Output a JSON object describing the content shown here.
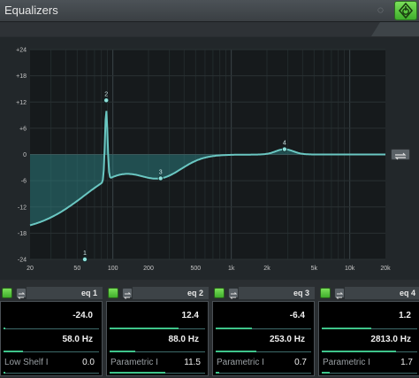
{
  "window": {
    "title": "Equalizers"
  },
  "icons": {
    "grey": "circle-icon",
    "power": "power-icon",
    "reset": "swap-icon",
    "switch": "swap-icon"
  },
  "graph": {
    "y_ticks": [
      "+24",
      "+18",
      "+12",
      "+6",
      "0",
      "-6",
      "-12",
      "-18",
      "-24"
    ],
    "y_values": [
      24,
      18,
      12,
      6,
      0,
      -6,
      -12,
      -18,
      -24
    ],
    "x_ticks": [
      "20",
      "50",
      "100",
      "200",
      "500",
      "1k",
      "2k",
      "5k",
      "10k",
      "20k"
    ],
    "x_values": [
      20,
      50,
      100,
      200,
      500,
      1000,
      2000,
      5000,
      10000,
      20000
    ],
    "ylim": [
      -24,
      24
    ],
    "xlim": [
      20,
      20000
    ],
    "grid": true,
    "scale_x": "log",
    "curve_color": "#6ac7c2",
    "fill_color": "#2c7a7c",
    "points": [
      {
        "label": "1",
        "freq": 58,
        "gain": -24
      },
      {
        "label": "2",
        "freq": 88,
        "gain": 12.4
      },
      {
        "label": "3",
        "freq": 253,
        "gain": -6.4
      },
      {
        "label": "4",
        "freq": 2813,
        "gain": 1.2
      }
    ]
  },
  "bands": [
    {
      "name": "eq 1",
      "gain": "-24.0",
      "freq": "58.0 Hz",
      "type": "Low Shelf I",
      "q": "0.0",
      "gain_level": 0.0,
      "freq_level": 0.2,
      "q_level": 0.0
    },
    {
      "name": "eq 2",
      "gain": "12.4",
      "freq": "88.0 Hz",
      "type": "Parametric I",
      "q": "11.5",
      "gain_level": 0.72,
      "freq_level": 0.27,
      "q_level": 0.58
    },
    {
      "name": "eq 3",
      "gain": "-6.4",
      "freq": "253.0 Hz",
      "type": "Parametric I",
      "q": "0.7",
      "gain_level": 0.38,
      "freq_level": 0.43,
      "q_level": 0.04
    },
    {
      "name": "eq 4",
      "gain": "1.2",
      "freq": "2813.0 Hz",
      "type": "Parametric I",
      "q": "1.7",
      "gain_level": 0.52,
      "freq_level": 0.78,
      "q_level": 0.08
    }
  ]
}
